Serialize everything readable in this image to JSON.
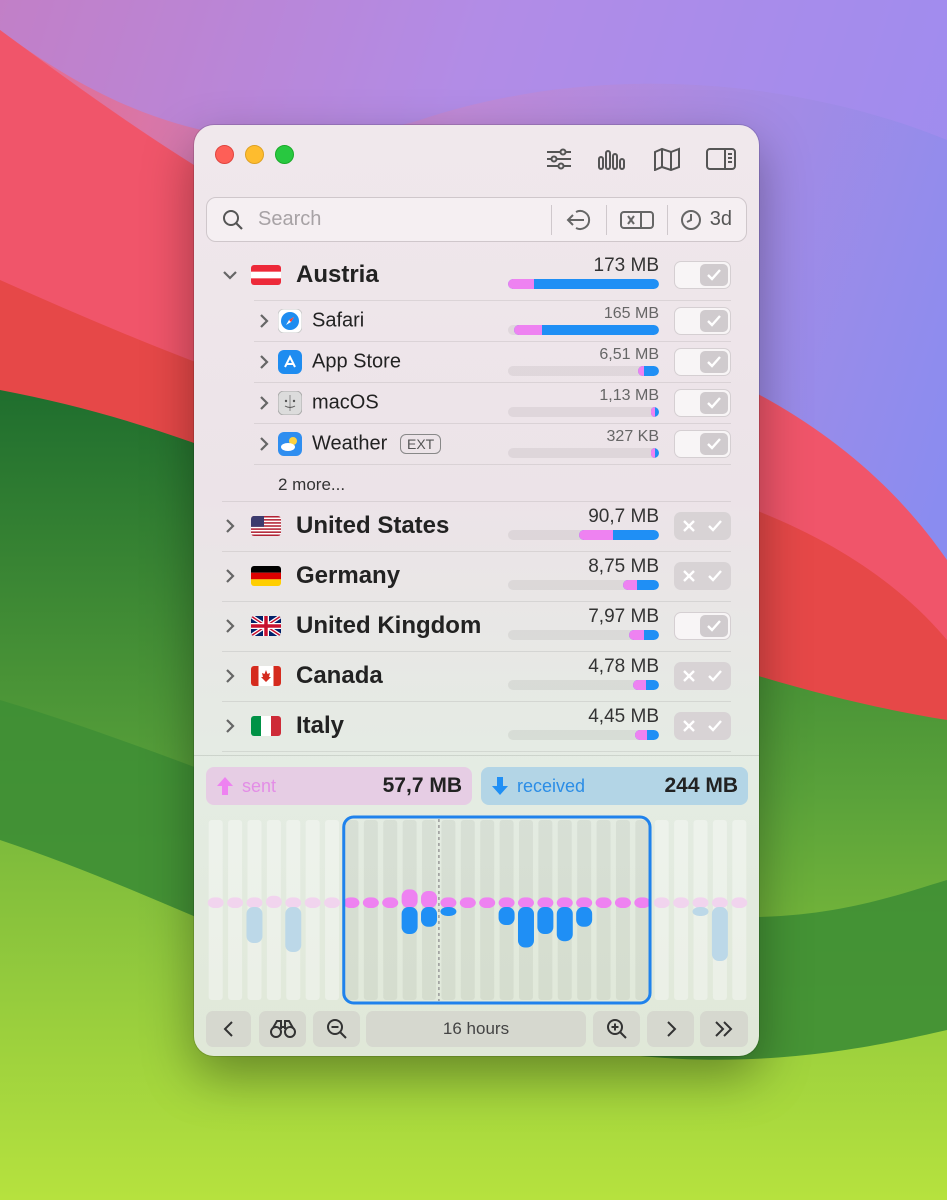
{
  "search": {
    "placeholder": "Search",
    "time_range": "3d"
  },
  "countries": [
    {
      "name": "Austria",
      "flag": "austria",
      "amount": "173 MB",
      "sent": 0.17,
      "total": 1.0,
      "expanded": true,
      "toggle": "on",
      "apps": [
        {
          "name": "Safari",
          "icon": "safari-icon",
          "amount": "165 MB",
          "sent": 0.19,
          "total": 0.96,
          "toggle": "on"
        },
        {
          "name": "App Store",
          "icon": "app-store-icon",
          "amount": "6,51 MB",
          "sent": 0.3,
          "total": 0.14,
          "toggle": "on"
        },
        {
          "name": "macOS",
          "icon": "macos-finder-icon",
          "amount": "1,13 MB",
          "sent": 0.5,
          "total": 0.05,
          "toggle": "on"
        },
        {
          "name": "Weather",
          "icon": "weather-icon",
          "badge": "EXT",
          "amount": "327 KB",
          "sent": 0.5,
          "total": 0.05,
          "toggle": "on"
        }
      ],
      "more_label": "2 more..."
    },
    {
      "name": "United States",
      "flag": "usa",
      "amount": "90,7 MB",
      "sent": 0.42,
      "total": 0.53,
      "toggle": "mixed"
    },
    {
      "name": "Germany",
      "flag": "germany",
      "amount": "8,75 MB",
      "sent": 0.38,
      "total": 0.24,
      "toggle": "mixed"
    },
    {
      "name": "United Kingdom",
      "flag": "uk",
      "amount": "7,97 MB",
      "sent": 0.5,
      "total": 0.2,
      "toggle": "on"
    },
    {
      "name": "Canada",
      "flag": "canada",
      "amount": "4,78 MB",
      "sent": 0.5,
      "total": 0.17,
      "toggle": "mixed"
    },
    {
      "name": "Italy",
      "flag": "italy",
      "amount": "4,45 MB",
      "sent": 0.5,
      "total": 0.16,
      "toggle": "mixed"
    }
  ],
  "summary": {
    "sent_label": "sent",
    "sent_value": "57,7 MB",
    "received_label": "received",
    "received_value": "244 MB"
  },
  "timeline": {
    "bars_sent": [
      0.12,
      0.12,
      0.12,
      0.14,
      0.12,
      0.12,
      0.12,
      0.12,
      0.12,
      0.12,
      0.22,
      0.2,
      0.12,
      0.12,
      0.12,
      0.12,
      0.12,
      0.12,
      0.12,
      0.12,
      0.12,
      0.12,
      0.12,
      0.12,
      0.12,
      0.12,
      0.12,
      0.12
    ],
    "bars_received": [
      0,
      0,
      0.4,
      0,
      0.5,
      0,
      0,
      0,
      0,
      0,
      0.3,
      0.22,
      0.1,
      0,
      0,
      0.2,
      0.45,
      0.3,
      0.38,
      0.22,
      0,
      0,
      0,
      0,
      0,
      0.1,
      0.6,
      0
    ],
    "selection_start_index": 7,
    "selection_end_index": 22,
    "selected_range": "16 hours"
  },
  "colors": {
    "sent": "#ee82f1",
    "received": "#1f8ff5",
    "selection": "#1f82ec"
  }
}
